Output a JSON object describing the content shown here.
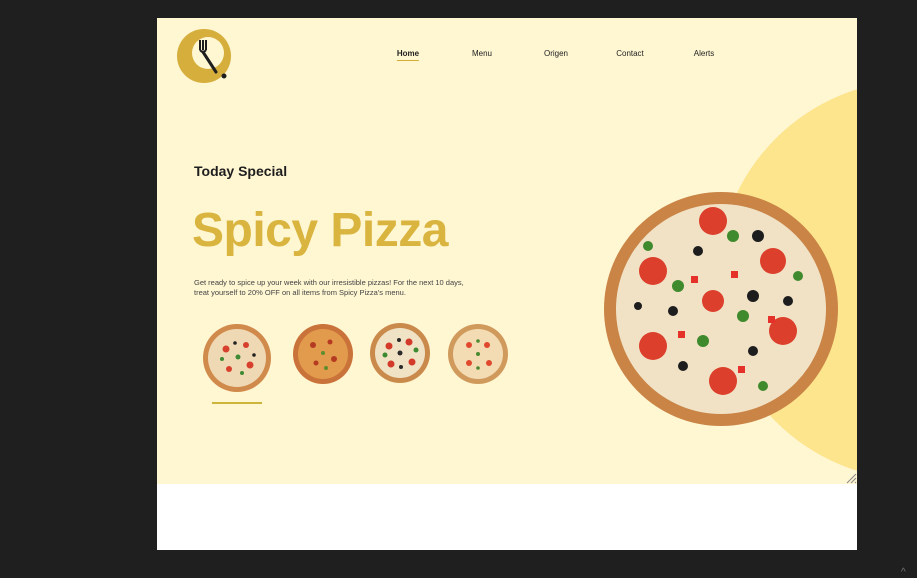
{
  "nav": {
    "items": [
      {
        "label": "Home",
        "active": true
      },
      {
        "label": "Menu",
        "active": false
      },
      {
        "label": "Origen",
        "active": false
      },
      {
        "label": "Contact",
        "active": false
      },
      {
        "label": "Alerts",
        "active": false
      }
    ]
  },
  "hero": {
    "subtitle": "Today Special",
    "title": "Spicy Pizza",
    "description_line1": "Get ready to spice up your week with our irresistible pizzas! For the next 10 days,",
    "description_line2": "treat yourself to 20% OFF on all items from Spicy Pizza's menu."
  },
  "thumbnails": [
    {
      "name": "pizza-thumbnail-1",
      "selected": true
    },
    {
      "name": "pizza-thumbnail-2",
      "selected": false
    },
    {
      "name": "pizza-thumbnail-3",
      "selected": false
    },
    {
      "name": "pizza-thumbnail-4",
      "selected": false
    }
  ],
  "colors": {
    "background": "#fff6d2",
    "accent": "#d9b43f",
    "circle": "#fde58e",
    "text": "#1e1e1e"
  },
  "icons": {
    "logo": "fork-knife-logo-icon",
    "hero_image": "pizza-image"
  }
}
